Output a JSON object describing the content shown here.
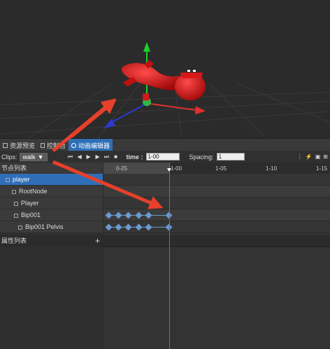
{
  "tabs": [
    {
      "label": "资源预览",
      "icon": "folder-icon"
    },
    {
      "label": "控制台",
      "icon": "console-icon"
    },
    {
      "label": "动画编辑器",
      "icon": "animation-icon"
    }
  ],
  "toolbar": {
    "clips_label": "Clips:",
    "clip_value": "walk",
    "time_label": "time :",
    "time_value": "1-00",
    "spacing_label": "Spacing:",
    "spacing_value": "1"
  },
  "node_panel": {
    "header": "节点列表",
    "nodes": [
      {
        "label": "player",
        "selected": true
      },
      {
        "label": "RootNode",
        "selected": false
      },
      {
        "label": "Player",
        "selected": false
      },
      {
        "label": "Bip001",
        "selected": false
      },
      {
        "label": "Bip001 Pelvis",
        "selected": false
      }
    ]
  },
  "property_panel": {
    "header": "属性列表",
    "add": "+"
  },
  "timeline": {
    "ticks": [
      "0-25",
      "1-00",
      "1-05",
      "1-10",
      "1-15"
    ]
  },
  "colors": {
    "accent": "#2f6fb8",
    "keyframe": "#6a9ad0",
    "playhead": "#c45050",
    "annotation": "#e8402a"
  }
}
